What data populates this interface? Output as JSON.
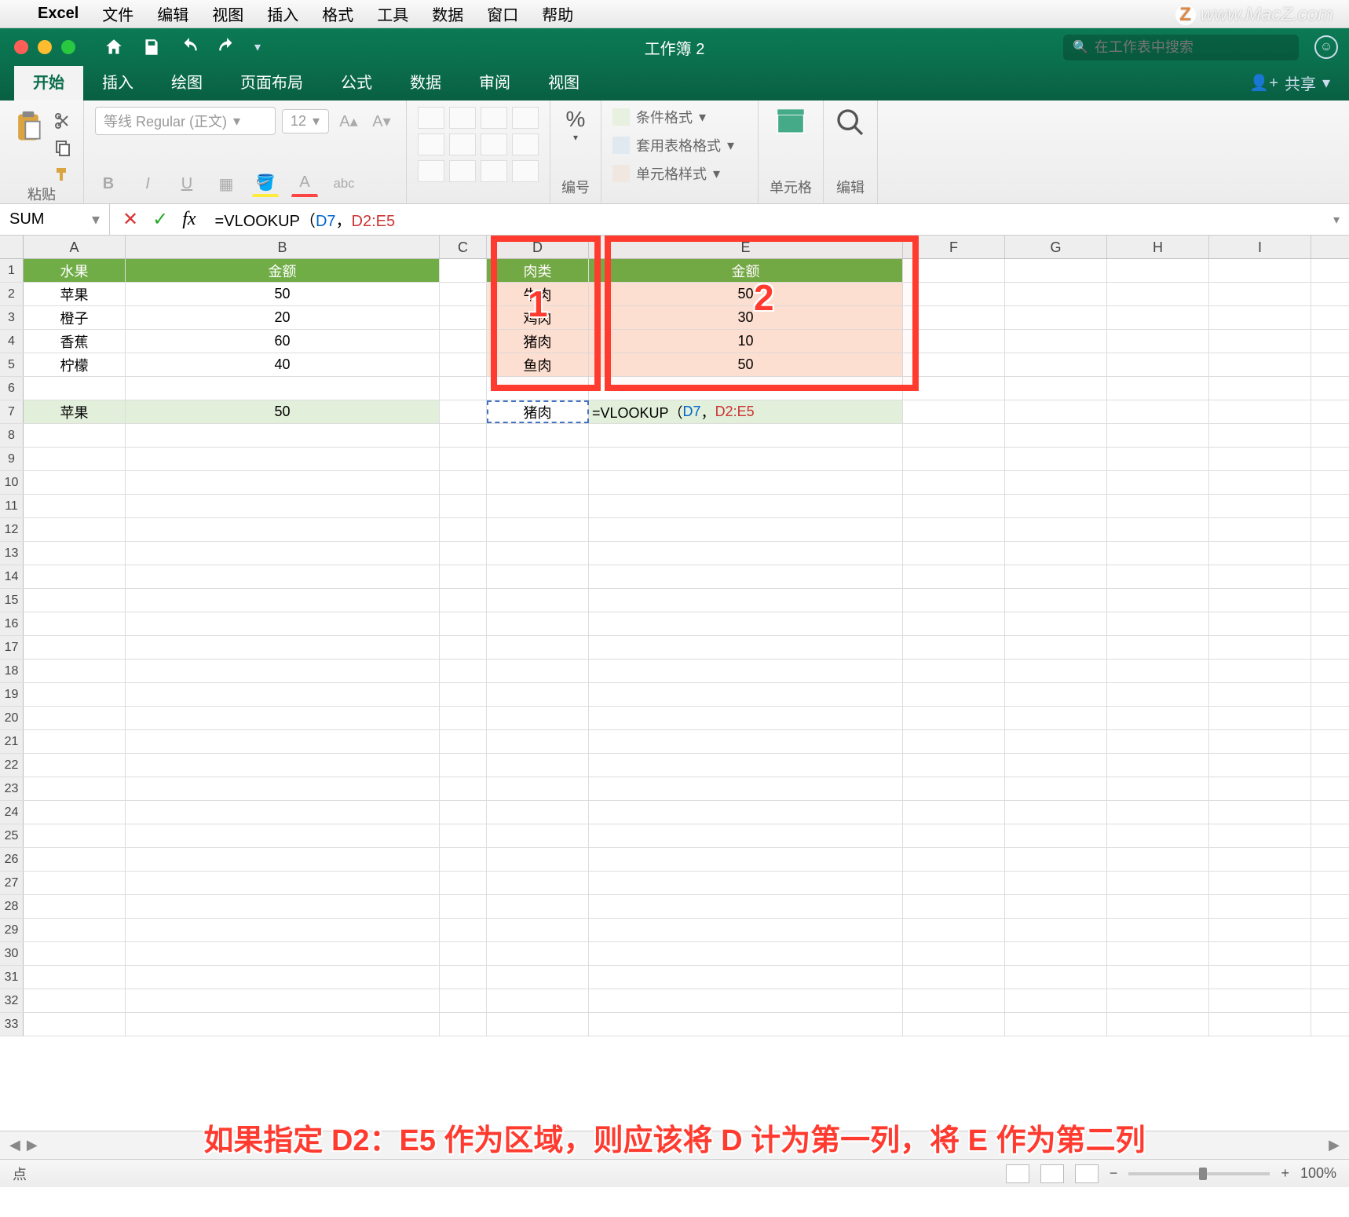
{
  "mac_menu": {
    "app": "Excel",
    "items": [
      "文件",
      "编辑",
      "视图",
      "插入",
      "格式",
      "工具",
      "数据",
      "窗口",
      "帮助"
    ]
  },
  "watermark": "www.MacZ.com",
  "titlebar": {
    "doc": "工作簿 2",
    "search_ph": "在工作表中搜索"
  },
  "ribbon_tabs": [
    "开始",
    "插入",
    "绘图",
    "页面布局",
    "公式",
    "数据",
    "审阅",
    "视图"
  ],
  "share": "共享",
  "ribbon": {
    "paste": "粘贴",
    "font_name": "等线 Regular (正文)",
    "font_size": "12",
    "number_group": "编号",
    "cond_fmt": "条件格式",
    "table_fmt": "套用表格格式",
    "cell_fmt": "单元格样式",
    "cells_group": "单元格",
    "edit_group": "编辑"
  },
  "formula": {
    "namebox": "SUM",
    "text_prefix": "=VLOOKUP（",
    "arg1": "D7",
    "sep": "，",
    "arg2": "D2:E5"
  },
  "columns": [
    "A",
    "B",
    "C",
    "D",
    "E",
    "F",
    "G",
    "H",
    "I"
  ],
  "table1": {
    "h1": "水果",
    "h2": "金额",
    "rows": [
      [
        "苹果",
        "50"
      ],
      [
        "橙子",
        "20"
      ],
      [
        "香蕉",
        "60"
      ],
      [
        "柠檬",
        "40"
      ]
    ]
  },
  "table2": {
    "h1": "肉类",
    "h2": "金额",
    "rows": [
      [
        "牛肉",
        "50"
      ],
      [
        "鸡肉",
        "30"
      ],
      [
        "猪肉",
        "10"
      ],
      [
        "鱼肉",
        "50"
      ]
    ]
  },
  "r7": {
    "a": "苹果",
    "b": "50",
    "d": "猪肉",
    "e": "=VLOOKUP（D7，D2:E5"
  },
  "callouts": {
    "n1": "1",
    "n2": "2"
  },
  "annotation": "如果指定 D2：E5 作为区域，则应该将 D 计为第一列，将 E 作为第二列",
  "status": {
    "mode": "点",
    "zoom": "100%"
  }
}
